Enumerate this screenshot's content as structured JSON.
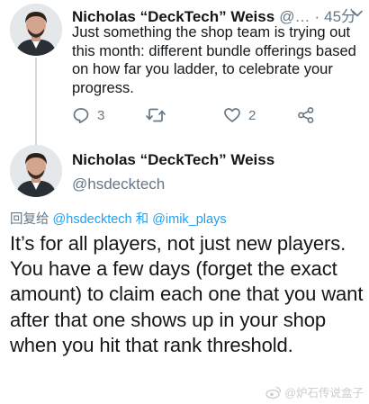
{
  "tweet1": {
    "author_name": "Nicholas “DeckTech” Weiss",
    "handle_truncated": "@…",
    "separator": "·",
    "time": "45分",
    "text": "Just something the shop team is trying out this month: different bundle offerings based on how far you ladder, to celebrate your progress.",
    "actions": {
      "reply_count": "3",
      "retweet_count": "",
      "like_count": "2"
    }
  },
  "tweet2": {
    "author_name": "Nicholas “DeckTech” Weiss",
    "handle": "@hsdecktech",
    "replying_prefix": "回复给",
    "replying_to_1": "@hsdecktech",
    "replying_joiner": "和",
    "replying_to_2": "@imik_plays",
    "text": "It’s for all players, not just new players. You have a few days (forget the exact amount) to claim each one that you want after that one shows up in your shop when you hit that rank threshold."
  },
  "watermark": {
    "text": "@炉石传说盒子"
  },
  "icons": {
    "reply": "reply-icon",
    "retweet": "retweet-icon",
    "like": "like-icon",
    "share": "share-icon",
    "more": "chevron-down-icon"
  },
  "colors": {
    "text": "#14171a",
    "secondary": "#657786",
    "link": "#1da1f2",
    "thread_line": "#cfd9de"
  }
}
